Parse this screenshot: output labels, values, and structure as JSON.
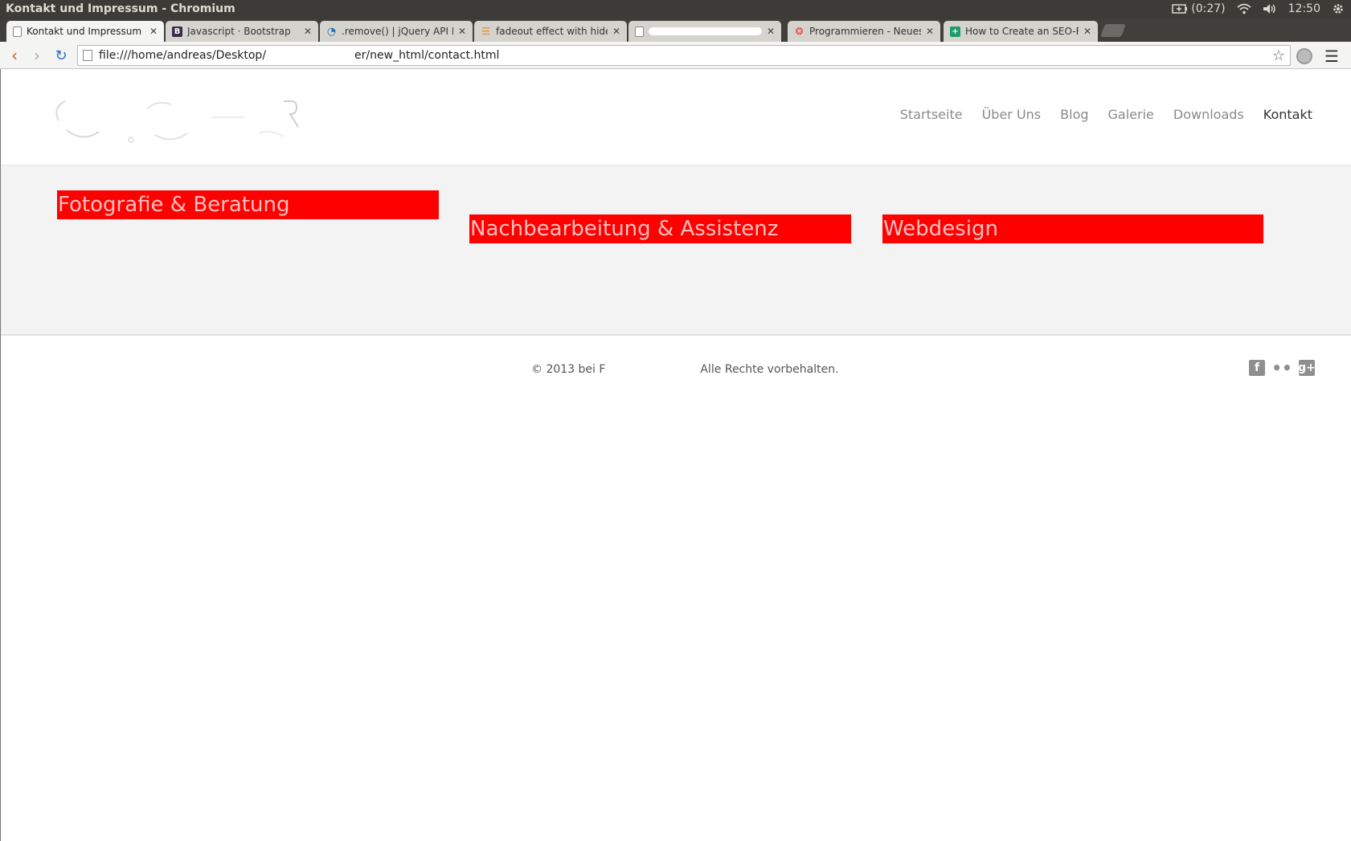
{
  "os": {
    "window_title": "Kontakt und Impressum - Chromium",
    "battery": "(0:27)",
    "clock": "12:50"
  },
  "tabs": [
    {
      "label": "Kontakt und Impressum",
      "icon": "page-icon",
      "active": true
    },
    {
      "label": "Javascript · Bootstrap",
      "icon": "bootstrap-icon",
      "active": false
    },
    {
      "label": ".remove() | jQuery API Do",
      "icon": "jquery-icon",
      "active": false
    },
    {
      "label": "fadeout effect with hide",
      "icon": "stackoverflow-icon",
      "active": false
    },
    {
      "label": "",
      "icon": "page-icon",
      "active": false
    },
    {
      "label": "Programmieren - Neues T",
      "icon": "forum-icon",
      "active": false
    },
    {
      "label": "How to Create an SEO-Fri",
      "icon": "plus-icon",
      "active": false
    }
  ],
  "toolbar": {
    "url_start": "file:///home/andreas/Desktop/",
    "url_end": "er/new_html/contact.html"
  },
  "site": {
    "nav": [
      "Startseite",
      "Über Uns",
      "Blog",
      "Galerie",
      "Downloads",
      "Kontakt"
    ],
    "active_nav": "Kontakt",
    "services": [
      "Fotografie & Beratung",
      "Nachbearbeitung & Assistenz",
      "Webdesign"
    ],
    "copyright_start": "© 2013 bei F",
    "copyright_end": "Alle Rechte vorbehalten.",
    "social": [
      "facebook-icon",
      "flickr-icon",
      "google-plus-icon"
    ]
  },
  "colors": {
    "service_bg": "#ff0000",
    "nav_active": "#333333",
    "nav_inactive": "#8a8a8a"
  }
}
